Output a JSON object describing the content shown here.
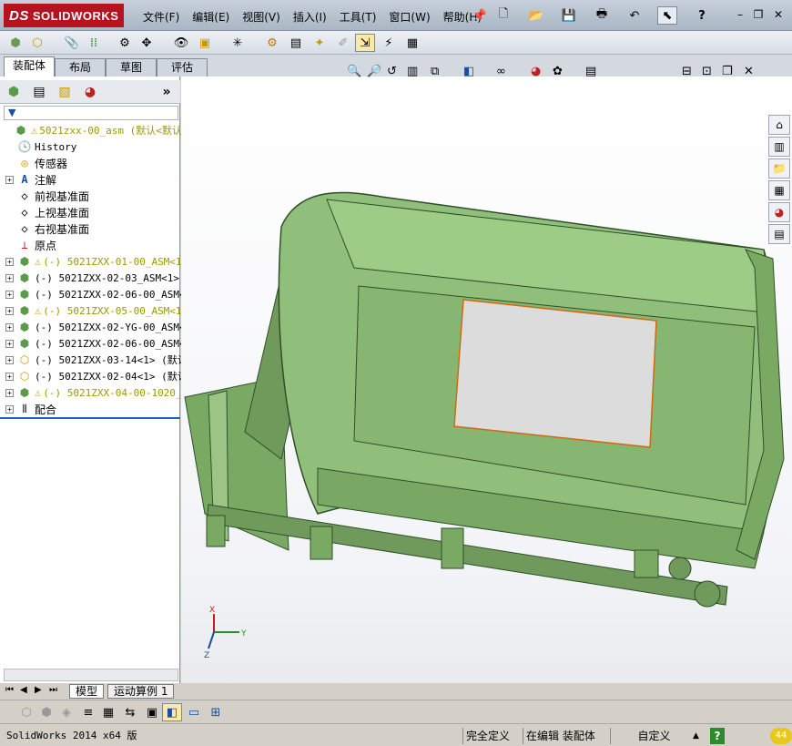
{
  "app": {
    "logo_prefix": "DS",
    "logo_name": "SOLIDWORKS"
  },
  "menu": [
    "文件(F)",
    "编辑(E)",
    "视图(V)",
    "插入(I)",
    "工具(T)",
    "窗口(W)",
    "帮助(H)"
  ],
  "window_buttons": {
    "minimize": "–",
    "restore": "❐",
    "close": "✕"
  },
  "help_glyph": "?",
  "command_tabs": [
    "装配体",
    "布局",
    "草图",
    "评估"
  ],
  "panel_more": "»",
  "filter_glyph": "▼",
  "tree": [
    {
      "label": "5021zxx-00_asm  (默认<默认",
      "warn": true,
      "yellow": true,
      "expand": false,
      "icon": "assembly-icon"
    },
    {
      "label": "History",
      "expand": false,
      "icon": "history-icon",
      "mono": true
    },
    {
      "label": "传感器",
      "expand": false,
      "icon": "sensor-icon"
    },
    {
      "label": "注解",
      "expand": true,
      "icon": "annotation-icon"
    },
    {
      "label": "前视基准面",
      "expand": false,
      "icon": "plane-icon"
    },
    {
      "label": "上视基准面",
      "expand": false,
      "icon": "plane-icon"
    },
    {
      "label": "右视基准面",
      "expand": false,
      "icon": "plane-icon"
    },
    {
      "label": "原点",
      "expand": false,
      "icon": "origin-icon"
    },
    {
      "label": "(-) 5021ZXX-01-00_ASM<1",
      "warn": true,
      "yellow": true,
      "expand": true,
      "icon": "subassembly-icon"
    },
    {
      "label": "(-) 5021ZXX-02-03_ASM<1>",
      "expand": true,
      "icon": "subassembly-icon"
    },
    {
      "label": "(-) 5021ZXX-02-06-00_ASM<",
      "expand": true,
      "icon": "subassembly-icon"
    },
    {
      "label": "(-) 5021ZXX-05-00_ASM<1",
      "warn": true,
      "yellow": true,
      "expand": true,
      "icon": "subassembly-icon"
    },
    {
      "label": "(-) 5021ZXX-02-YG-00_ASM<",
      "expand": true,
      "icon": "subassembly-icon"
    },
    {
      "label": "(-) 5021ZXX-02-06-00_ASM<",
      "expand": true,
      "icon": "subassembly-icon"
    },
    {
      "label": "(-) 5021ZXX-03-14<1> (默认",
      "expand": true,
      "icon": "part-icon"
    },
    {
      "label": "(-) 5021ZXX-02-04<1> (默认",
      "expand": true,
      "icon": "part-icon"
    },
    {
      "label": "(-) 5021ZXX-04-00-1020_",
      "warn": true,
      "yellow": true,
      "expand": true,
      "icon": "subassembly-icon"
    },
    {
      "label": "配合",
      "expand": true,
      "icon": "mates-icon"
    }
  ],
  "bottom_tabs": [
    "模型",
    "运动算例 1"
  ],
  "triad": {
    "x": "X",
    "y": "Y",
    "z": "Z"
  },
  "status": {
    "version": "SolidWorks 2014 x64 版",
    "fully_defined": "完全定义",
    "editing": "在编辑 装配体",
    "custom": "自定义",
    "arrow": "▲",
    "help": "?",
    "counter": "44"
  },
  "colors": {
    "model_green": "#8fbf7a",
    "model_dark": "#3c6b32",
    "accent_red": "#b4131f",
    "tree_sep": "#1f5fb8"
  }
}
